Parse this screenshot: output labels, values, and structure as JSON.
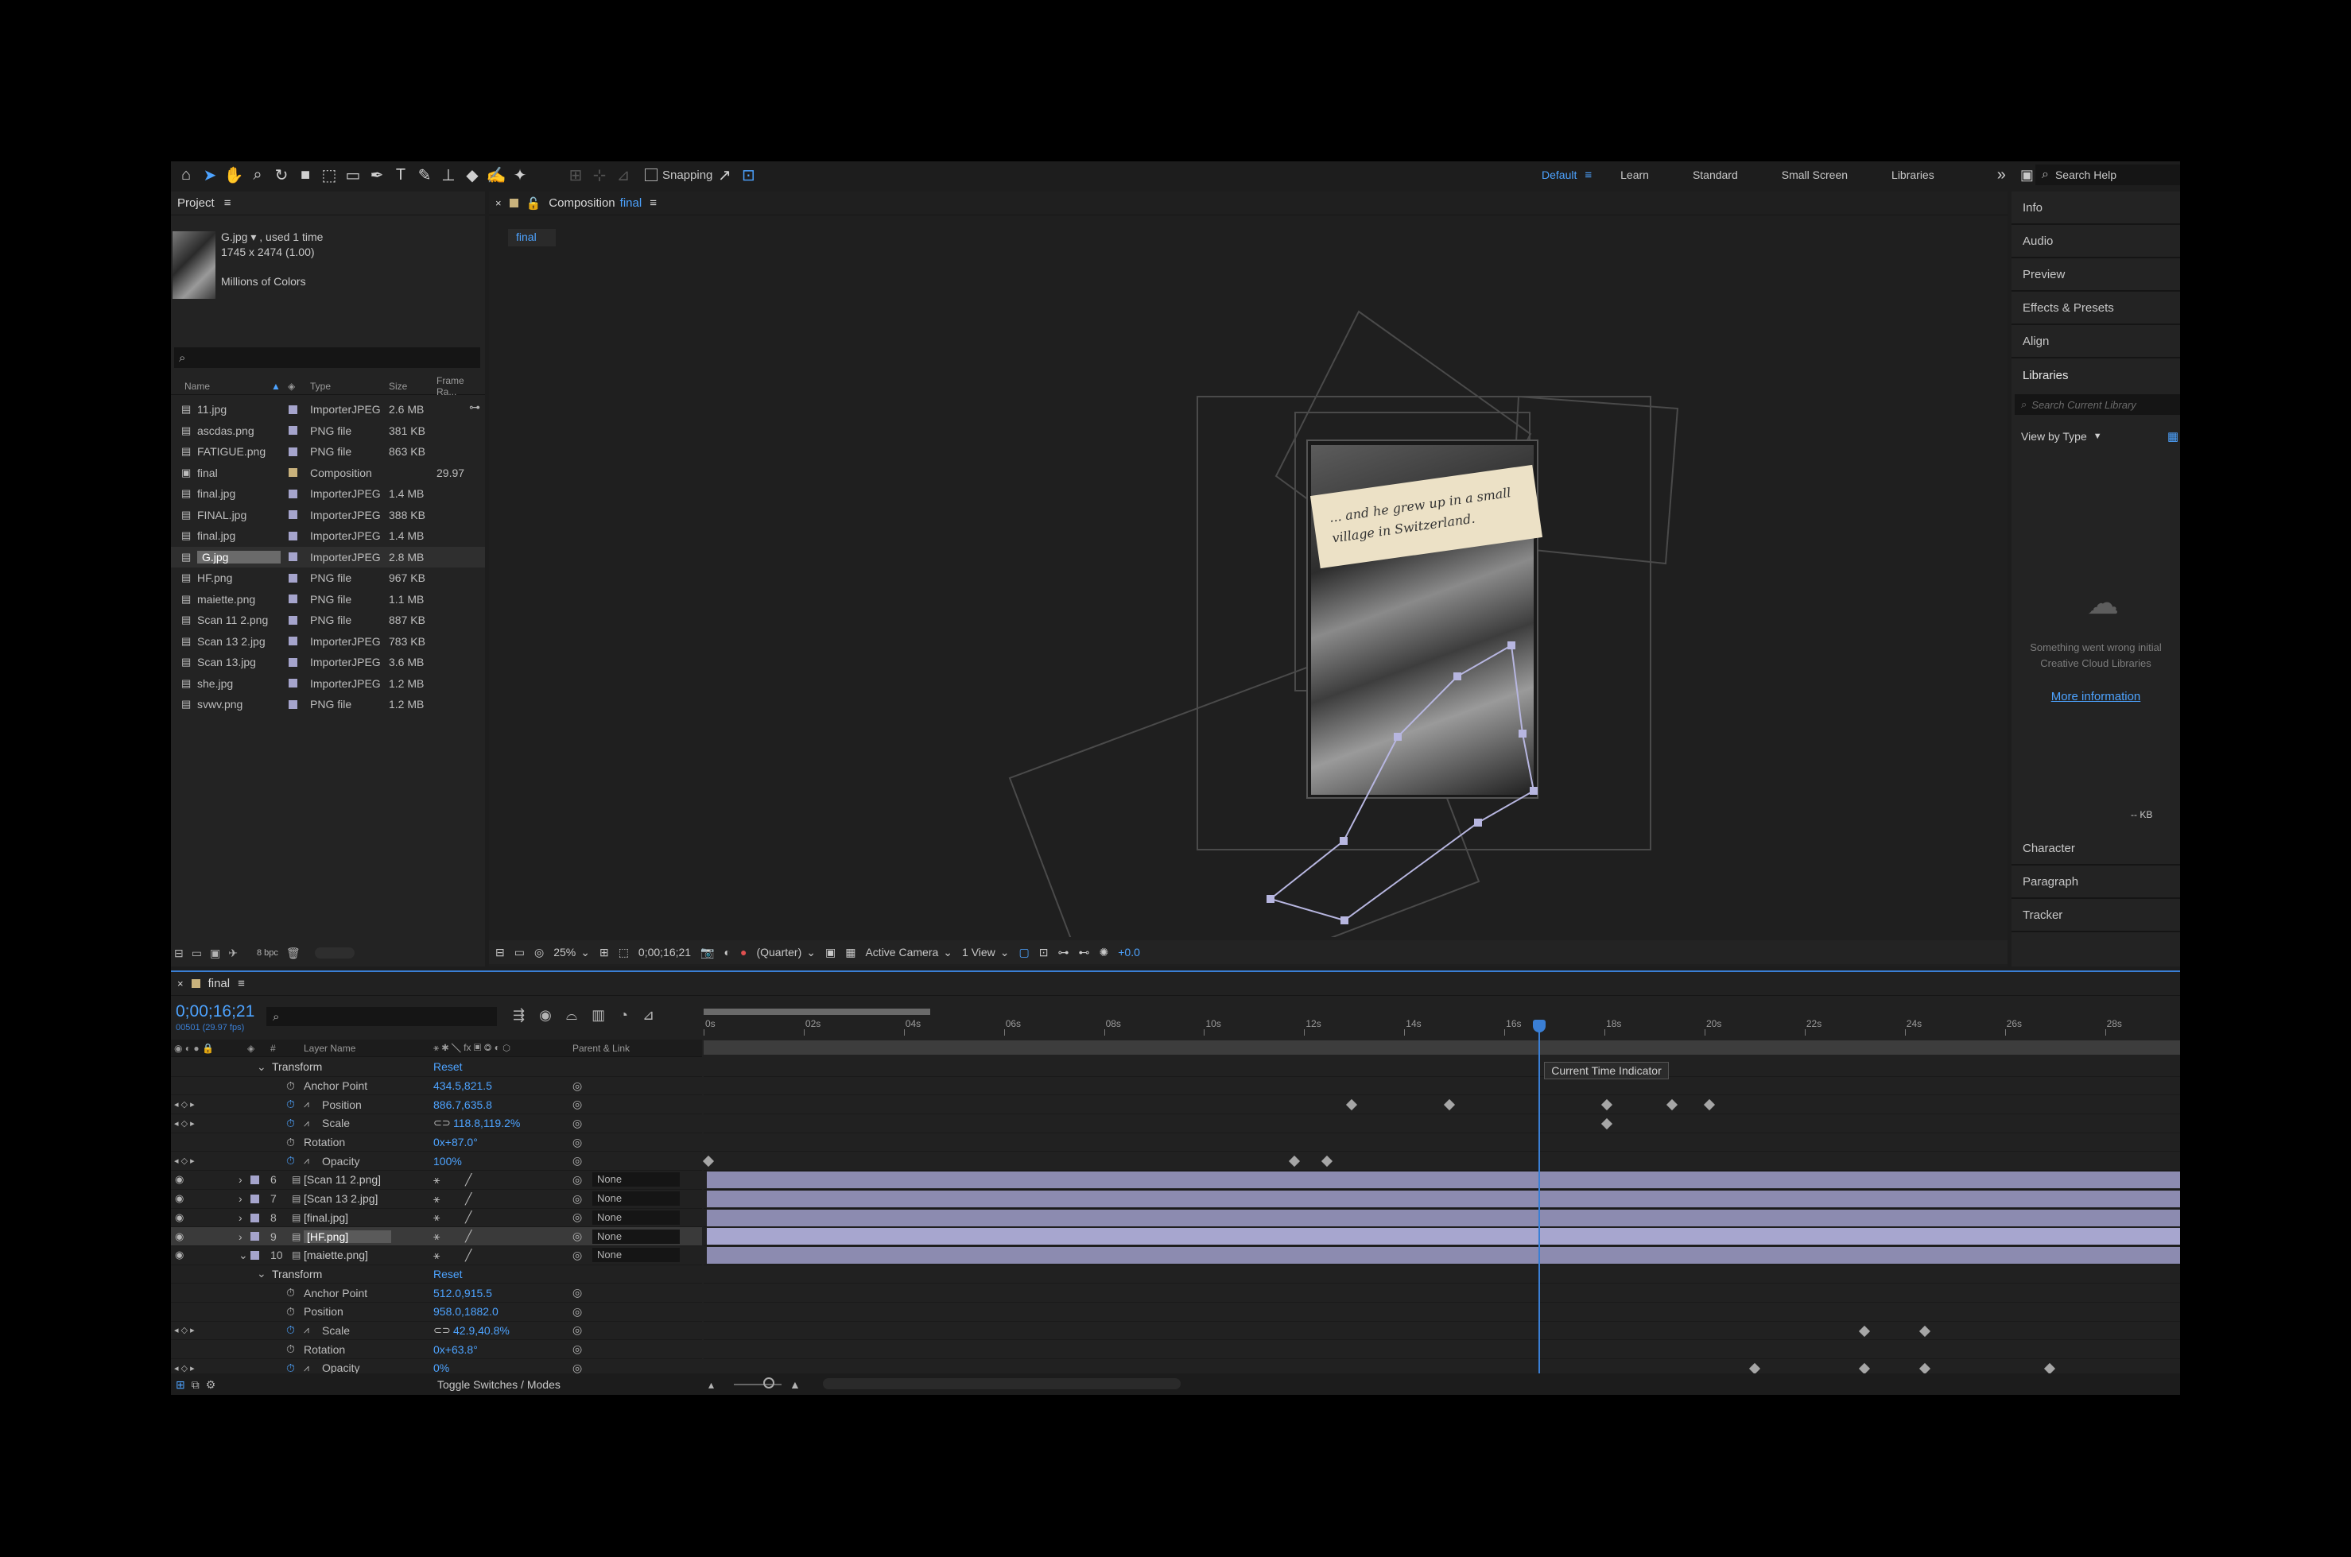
{
  "toolbar": {
    "snapping_label": "Snapping",
    "workspaces": [
      "Default",
      "Learn",
      "Standard",
      "Small Screen",
      "Libraries"
    ],
    "search_placeholder": "Search Help"
  },
  "project": {
    "title": "Project",
    "file_name": "G.jpg ▾ , used 1 time",
    "dims": "1745 x 2474 (1.00)",
    "colors": "Millions of Colors",
    "columns": [
      "Name",
      "Type",
      "Size",
      "Frame Ra..."
    ],
    "items": [
      {
        "name": "11.jpg",
        "type": "ImporterJPEG",
        "size": "2.6 MB",
        "fr": "",
        "color": "#a5a4cc"
      },
      {
        "name": "ascdas.png",
        "type": "PNG file",
        "size": "381 KB",
        "fr": "",
        "color": "#a5a4cc"
      },
      {
        "name": "FATIGUE.png",
        "type": "PNG file",
        "size": "863 KB",
        "fr": "",
        "color": "#a5a4cc"
      },
      {
        "name": "final",
        "type": "Composition",
        "size": "",
        "fr": "29.97",
        "color": "#c9b27c"
      },
      {
        "name": "final.jpg",
        "type": "ImporterJPEG",
        "size": "1.4 MB",
        "fr": "",
        "color": "#a5a4cc"
      },
      {
        "name": "FINAL.jpg",
        "type": "ImporterJPEG",
        "size": "388 KB",
        "fr": "",
        "color": "#a5a4cc"
      },
      {
        "name": "final.jpg",
        "type": "ImporterJPEG",
        "size": "1.4 MB",
        "fr": "",
        "color": "#a5a4cc"
      },
      {
        "name": "G.jpg",
        "type": "ImporterJPEG",
        "size": "2.8 MB",
        "fr": "",
        "color": "#a5a4cc"
      },
      {
        "name": "HF.png",
        "type": "PNG file",
        "size": "967 KB",
        "fr": "",
        "color": "#a5a4cc"
      },
      {
        "name": "maiette.png",
        "type": "PNG file",
        "size": "1.1 MB",
        "fr": "",
        "color": "#a5a4cc"
      },
      {
        "name": "Scan 11 2.png",
        "type": "PNG file",
        "size": "887 KB",
        "fr": "",
        "color": "#a5a4cc"
      },
      {
        "name": "Scan 13 2.jpg",
        "type": "ImporterJPEG",
        "size": "783 KB",
        "fr": "",
        "color": "#a5a4cc"
      },
      {
        "name": "Scan 13.jpg",
        "type": "ImporterJPEG",
        "size": "3.6 MB",
        "fr": "",
        "color": "#a5a4cc"
      },
      {
        "name": "she.jpg",
        "type": "ImporterJPEG",
        "size": "1.2 MB",
        "fr": "",
        "color": "#a5a4cc"
      },
      {
        "name": "svwv.png",
        "type": "PNG file",
        "size": "1.2 MB",
        "fr": "",
        "color": "#a5a4cc"
      }
    ],
    "bpc": "8 bpc"
  },
  "comp": {
    "title_prefix": "Composition",
    "title_name": "final",
    "tab": "final",
    "note_line1": "... and he grew up in a small",
    "note_line2": "village in Switzerland.",
    "zoom": "25%",
    "timecode": "0;00;16;21",
    "resolution": "(Quarter)",
    "camera": "Active Camera",
    "views": "1 View",
    "exposure": "+0.0"
  },
  "right_panel": {
    "tabs_top": [
      "Info",
      "Audio",
      "Preview",
      "Effects & Presets",
      "Align",
      "Libraries"
    ],
    "search_placeholder": "Search Current Library",
    "view_by": "View by Type",
    "error_line1": "Something went wrong initial",
    "error_line2": "Creative Cloud Libraries",
    "more_info": "More information",
    "kb": "-- KB",
    "tabs_bottom": [
      "Character",
      "Paragraph",
      "Tracker"
    ]
  },
  "timeline": {
    "tab": "final",
    "timecode": "0;00;16;21",
    "fps": "00501 (29.97 fps)",
    "col_layer": "Layer Name",
    "col_parent": "Parent & Link",
    "ticks": [
      "0s",
      "02s",
      "04s",
      "06s",
      "08s",
      "10s",
      "12s",
      "14s",
      "16s",
      "18s",
      "20s",
      "22s",
      "24s",
      "26s",
      "28s"
    ],
    "tooltip": "Current Time Indicator",
    "toggle": "Toggle Switches / Modes",
    "rows": [
      {
        "kind": "group",
        "label": "Transform",
        "value": "Reset"
      },
      {
        "kind": "prop",
        "label": "Anchor Point",
        "value": "434.5,821.5"
      },
      {
        "kind": "prop",
        "label": "Position",
        "value": "886.7,635.8",
        "anim": true,
        "keys": [
          12.95,
          14.9,
          18.05,
          19.35,
          20.1
        ]
      },
      {
        "kind": "prop",
        "label": "Scale",
        "value": "118.8,119.2%",
        "anim": true,
        "keys": [
          18.05
        ]
      },
      {
        "kind": "prop",
        "label": "Rotation",
        "value": "0x+87.0°"
      },
      {
        "kind": "prop",
        "label": "Opacity",
        "value": "100%",
        "anim": true,
        "keys": [
          0.1,
          11.8,
          12.45
        ]
      },
      {
        "kind": "layer",
        "num": "6",
        "label": "[Scan 11 2.png]",
        "parent": "None"
      },
      {
        "kind": "layer",
        "num": "7",
        "label": "[Scan 13 2.jpg]",
        "parent": "None"
      },
      {
        "kind": "layer",
        "num": "8",
        "label": "[final.jpg]",
        "parent": "None"
      },
      {
        "kind": "layer",
        "num": "9",
        "label": "[HF.png]",
        "parent": "None",
        "selected": true
      },
      {
        "kind": "layer",
        "num": "10",
        "label": "[maiette.png]",
        "parent": "None",
        "open": true
      },
      {
        "kind": "group",
        "label": "Transform",
        "value": "Reset"
      },
      {
        "kind": "prop",
        "label": "Anchor Point",
        "value": "512.0,915.5"
      },
      {
        "kind": "prop",
        "label": "Position",
        "value": "958.0,1882.0"
      },
      {
        "kind": "prop",
        "label": "Scale",
        "value": "42.9,40.8%",
        "anim": true,
        "keys": [
          23.2,
          24.4
        ]
      },
      {
        "kind": "prop",
        "label": "Rotation",
        "value": "0x+63.8°"
      },
      {
        "kind": "prop",
        "label": "Opacity",
        "value": "0%",
        "anim": true,
        "keys": [
          21.0,
          23.2,
          24.4,
          26.9
        ]
      }
    ],
    "cti_seconds": 16.7,
    "duration_seconds": 29.5
  }
}
